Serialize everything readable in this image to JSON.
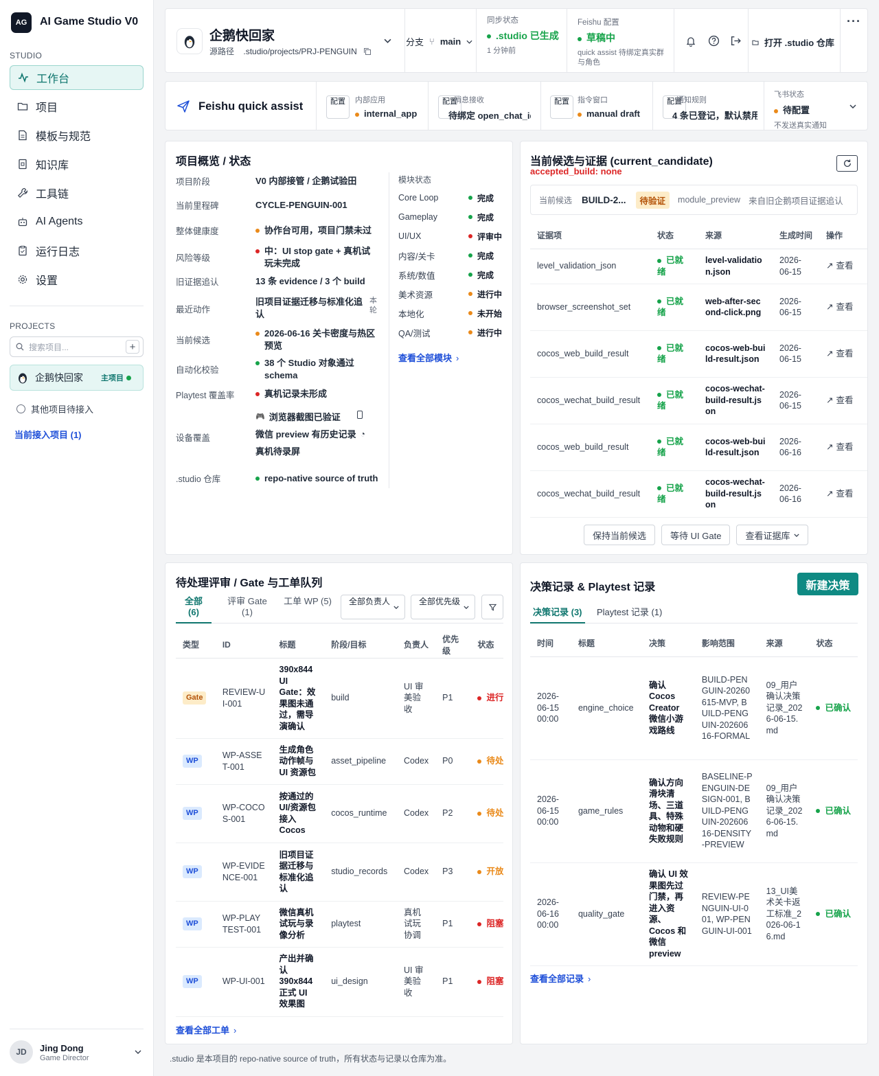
{
  "app": {
    "logo_text": "AG",
    "title": "AI Game Studio V0"
  },
  "sidebar": {
    "studio_label": "STUDIO",
    "nav": [
      {
        "label": "工作台",
        "icon": "activity-icon"
      },
      {
        "label": "项目",
        "icon": "folder-icon"
      },
      {
        "label": "模板与规范",
        "icon": "document-icon"
      },
      {
        "label": "知识库",
        "icon": "book-icon"
      },
      {
        "label": "工具链",
        "icon": "wrench-icon"
      },
      {
        "label": "AI Agents",
        "icon": "robot-icon"
      },
      {
        "label": "运行日志",
        "icon": "clipboard-icon"
      },
      {
        "label": "设置",
        "icon": "gear-icon"
      }
    ],
    "projects_label": "PROJECTS",
    "search_placeholder": "搜索项目...",
    "project": {
      "name": "企鹅快回家",
      "tag": "主项目"
    },
    "other_project": "其他项目待接入",
    "current_link": "当前接入项目 (1)",
    "user": {
      "initials": "JD",
      "name": "Jing Dong",
      "role": "Game Director"
    }
  },
  "header": {
    "project_name": "企鹅快回家",
    "source_label": "源路径",
    "source_path": ".studio/projects/PRJ-PENGUIN",
    "branch_label": "分支",
    "branch": "main",
    "sync_label": "同步状态",
    "sync_status": ".studio 已生成",
    "sync_time": "1 分钟前",
    "feishu_label": "Feishu 配置",
    "feishu_status": "草稿中",
    "feishu_desc": "quick assist 待绑定真实群与角色",
    "open_repo": "打开 .studio 仓库"
  },
  "feishu_bar": {
    "title": "Feishu quick assist",
    "config_tag": "配置",
    "items": [
      {
        "label": "内部应用",
        "value": "internal_app",
        "dot": "o"
      },
      {
        "label": "消息接收",
        "value": "待绑定 open_chat_id",
        "dot": ""
      },
      {
        "label": "指令窗口",
        "value": "manual draft",
        "dot": "o"
      },
      {
        "label": "通知规则",
        "value": "4 条已登记，默认禁用",
        "dot": ""
      }
    ],
    "status_label": "飞书状态",
    "status_value": "待配置",
    "status_desc": "不发送真实通知"
  },
  "overview": {
    "title": "项目概览 / 状态",
    "rows": [
      {
        "label": "项目阶段",
        "value": "V0 内部接管 / 企鹅试验田",
        "dot": ""
      },
      {
        "label": "当前里程碑",
        "value": "CYCLE-PENGUIN-001",
        "dot": ""
      },
      {
        "label": "整体健康度",
        "value": "协作台可用，项目门禁未过",
        "dot": "o"
      },
      {
        "label": "风险等级",
        "value": "中：UI stop gate + 真机试玩未完成",
        "dot": "r"
      },
      {
        "label": "旧证据追认",
        "value": "13 条 evidence / 3 个 build",
        "dot": ""
      },
      {
        "label": "最近动作",
        "value": "旧项目证据迁移与标准化追认",
        "dot": "",
        "note": "本轮"
      },
      {
        "label": "当前候选",
        "value": "2026-06-16 关卡密度与热区预览",
        "dot": "o"
      },
      {
        "label": "自动化校验",
        "value": "38 个 Studio 对象通过 schema",
        "dot": "g"
      },
      {
        "label": "Playtest 覆盖率",
        "value": "真机记录未形成",
        "dot": "r"
      }
    ],
    "device_label": "设备覆盖",
    "devices": [
      "浏览器截图已验证",
      "微信 preview 有历史记录",
      "真机待录屏"
    ],
    "repo_label": ".studio 仓库",
    "repo_value": "repo-native source of truth",
    "modules_title": "模块状态",
    "modules": [
      {
        "name": "Core Loop",
        "status": "完成",
        "dot": "g"
      },
      {
        "name": "Gameplay",
        "status": "完成",
        "dot": "g"
      },
      {
        "name": "UI/UX",
        "status": "评审中",
        "dot": "r"
      },
      {
        "name": "内容/关卡",
        "status": "完成",
        "dot": "g"
      },
      {
        "name": "系统/数值",
        "status": "完成",
        "dot": "g"
      },
      {
        "name": "美术资源",
        "status": "进行中",
        "dot": "o"
      },
      {
        "name": "本地化",
        "status": "未开始",
        "dot": "o"
      },
      {
        "name": "QA/测试",
        "status": "进行中",
        "dot": "o"
      }
    ],
    "modules_link": "查看全部模块"
  },
  "candidate": {
    "title": "当前候选与证据 (current_candidate)",
    "accepted": "accepted_build: none",
    "info_label": "当前候选",
    "build": "BUILD-2...",
    "badge": "待验证",
    "module": "module_preview",
    "origin": "来自旧企鹅项目证据追认",
    "columns": [
      "证据项",
      "状态",
      "来源",
      "生成时间",
      "操作"
    ],
    "rows": [
      {
        "item": "level_validation_json",
        "status": "已就绪",
        "source": "level-validation.json",
        "time": "2026-06-15",
        "action": "查看"
      },
      {
        "item": "browser_screenshot_set",
        "status": "已就绪",
        "source": "web-after-second-click.png",
        "time": "2026-06-15",
        "action": "查看"
      },
      {
        "item": "cocos_web_build_result",
        "status": "已就绪",
        "source": "cocos-web-build-result.json",
        "time": "2026-06-15",
        "action": "查看"
      },
      {
        "item": "cocos_wechat_build_result",
        "status": "已就绪",
        "source": "cocos-wechat-build-result.json",
        "time": "2026-06-15",
        "action": "查看"
      },
      {
        "item": "cocos_web_build_result",
        "status": "已就绪",
        "source": "cocos-web-build-result.json",
        "time": "2026-06-16",
        "action": "查看"
      },
      {
        "item": "cocos_wechat_build_result",
        "status": "已就绪",
        "source": "cocos-wechat-build-result.json",
        "time": "2026-06-16",
        "action": "查看"
      }
    ],
    "buttons": [
      "保持当前候选",
      "等待 UI Gate",
      "查看证据库"
    ]
  },
  "queue": {
    "title": "待处理评审 / Gate 与工单队列",
    "tabs": [
      "全部 (6)",
      "评审 Gate (1)",
      "工单 WP (5)"
    ],
    "filters": [
      "全部负责人",
      "全部优先级"
    ],
    "columns": [
      "类型",
      "ID",
      "标题",
      "阶段/目标",
      "负责人",
      "优先级",
      "状态"
    ],
    "rows": [
      {
        "type": "Gate",
        "id": "REVIEW-UI-001",
        "title": "390x844 UI Gate：效果图未通过，需导演确认",
        "stage": "build",
        "owner": "UI 审美验收",
        "priority": "P1",
        "status": "进行中",
        "dot": "r"
      },
      {
        "type": "WP",
        "id": "WP-ASSET-001",
        "title": "生成角色动作帧与 UI 资源包",
        "stage": "asset_pipeline",
        "owner": "Codex",
        "priority": "P0",
        "status": "待处理",
        "dot": "o"
      },
      {
        "type": "WP",
        "id": "WP-COCOS-001",
        "title": "按通过的 UI/资源包接入 Cocos",
        "stage": "cocos_runtime",
        "owner": "Codex",
        "priority": "P2",
        "status": "待处理",
        "dot": "o"
      },
      {
        "type": "WP",
        "id": "WP-EVIDENCE-001",
        "title": "旧项目证据迁移与标准化追认",
        "stage": "studio_records",
        "owner": "Codex",
        "priority": "P3",
        "status": "开放",
        "dot": "o"
      },
      {
        "type": "WP",
        "id": "WP-PLAYTEST-001",
        "title": "微信真机试玩与录像分析",
        "stage": "playtest",
        "owner": "真机试玩协调",
        "priority": "P1",
        "status": "阻塞",
        "dot": "r"
      },
      {
        "type": "WP",
        "id": "WP-UI-001",
        "title": "产出并确认 390x844 正式 UI 效果图",
        "stage": "ui_design",
        "owner": "UI 审美验收",
        "priority": "P1",
        "status": "阻塞",
        "dot": "r"
      }
    ],
    "link": "查看全部工单"
  },
  "decisions": {
    "title": "决策记录 & Playtest 记录",
    "new_button": "新建决策",
    "tabs": [
      "决策记录 (3)",
      "Playtest 记录 (1)"
    ],
    "columns": [
      "时间",
      "标题",
      "决策",
      "影响范围",
      "来源",
      "状态"
    ],
    "rows": [
      {
        "time": "2026-06-15 00:00",
        "title": "engine_choice",
        "decision": "确认 Cocos Creator 微信小游戏路线",
        "scope": "BUILD-PENGUIN-20260615-MVP, BUILD-PENGUIN-20260616-FORMAL",
        "source": "09_用户确认决策记录_2026-06-15.md",
        "status": "已确认"
      },
      {
        "time": "2026-06-15 00:00",
        "title": "game_rules",
        "decision": "确认方向滑块清场、三道具、特殊动物和硬失败规则",
        "scope": "BASELINE-PENGUIN-DESIGN-001, BUILD-PENGUIN-20260616-DENSITY-PREVIEW",
        "source": "09_用户确认决策记录_2026-06-15.md",
        "status": "已确认"
      },
      {
        "time": "2026-06-16 00:00",
        "title": "quality_gate",
        "decision": "确认 UI 效果图先过门禁，再进入资源、Cocos 和微信 preview",
        "scope": "REVIEW-PENGUIN-UI-001, WP-PENGUIN-UI-001",
        "source": "13_UI美术关卡返工标准_2026-06-16.md",
        "status": "已确认"
      }
    ],
    "link": "查看全部记录"
  },
  "footer": ".studio 是本项目的 repo-native source of truth，所有状态与记录以仓库为准。"
}
